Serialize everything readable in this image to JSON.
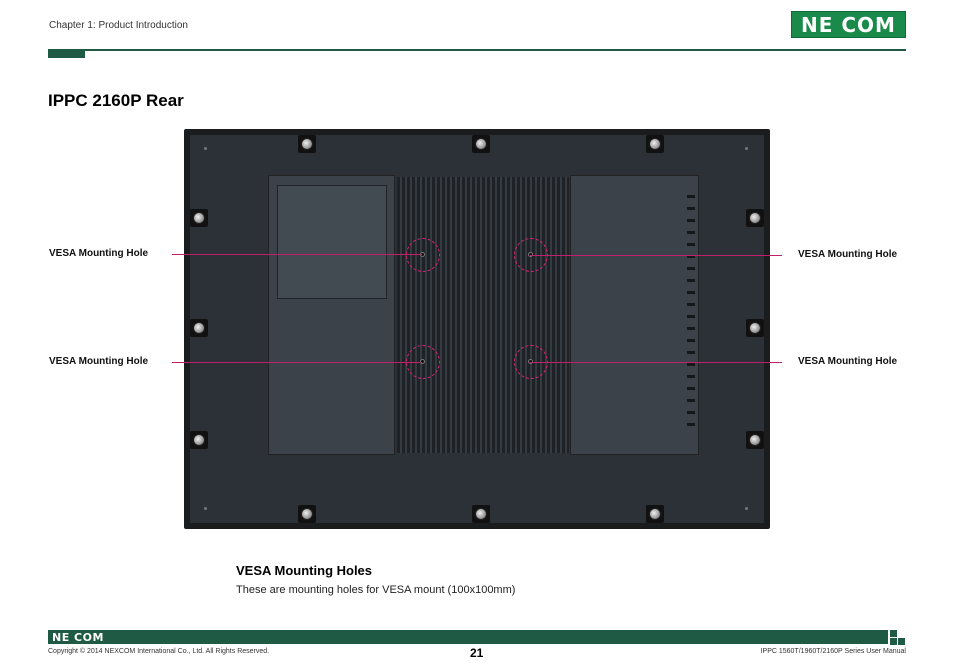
{
  "header": {
    "chapter": "Chapter 1: Product Introduction",
    "logo": "NE COM"
  },
  "section": {
    "title": "IPPC 2160P Rear"
  },
  "figure": {
    "callouts": {
      "top_left": "VESA Mounting Hole",
      "top_right": "VESA Mounting Hole",
      "bottom_left": "VESA Mounting Hole",
      "bottom_right": "VESA Mounting Hole"
    },
    "colors": {
      "callout": "#c21f6a",
      "panel": "#2b3137"
    }
  },
  "description": {
    "heading": "VESA Mounting Holes",
    "text": "These are mounting holes for VESA mount (100x100mm)"
  },
  "footer": {
    "logo": "NE COM",
    "copyright": "Copyright © 2014 NEXCOM International Co., Ltd. All Rights Reserved.",
    "page_number": "21",
    "manual": "IPPC 1560T/1960T/2160P Series User Manual",
    "brand_color": "#1f5a45"
  }
}
